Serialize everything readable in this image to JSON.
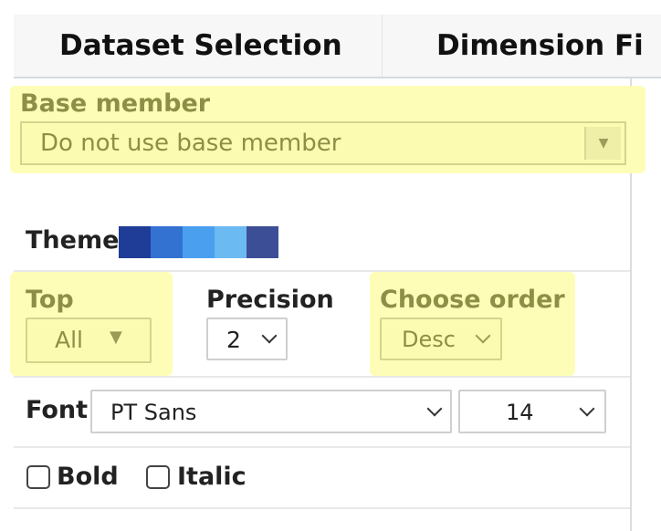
{
  "tabs": [
    {
      "label": "Dataset Selection"
    },
    {
      "label": "Dimension Fi"
    }
  ],
  "base_member": {
    "label": "Base member",
    "value": "Do not use base member",
    "button_icon": "caret-down-icon"
  },
  "theme": {
    "label": "Theme",
    "colors": [
      "#1f3c96",
      "#3472d2",
      "#4aa0ee",
      "#6cbaf2",
      "#3c4f96"
    ]
  },
  "top": {
    "label": "Top",
    "value": "All"
  },
  "precision": {
    "label": "Precision",
    "value": "2"
  },
  "order": {
    "label": "Choose order",
    "value": "Desc"
  },
  "font": {
    "label": "Font",
    "family": "PT Sans",
    "size": "14"
  },
  "bold": {
    "label": "Bold",
    "checked": false
  },
  "italic": {
    "label": "Italic",
    "checked": false
  },
  "colors": {
    "highlight": "#fdfdb8",
    "olive_text": "#8e8f46",
    "border": "#cfcfcf"
  }
}
